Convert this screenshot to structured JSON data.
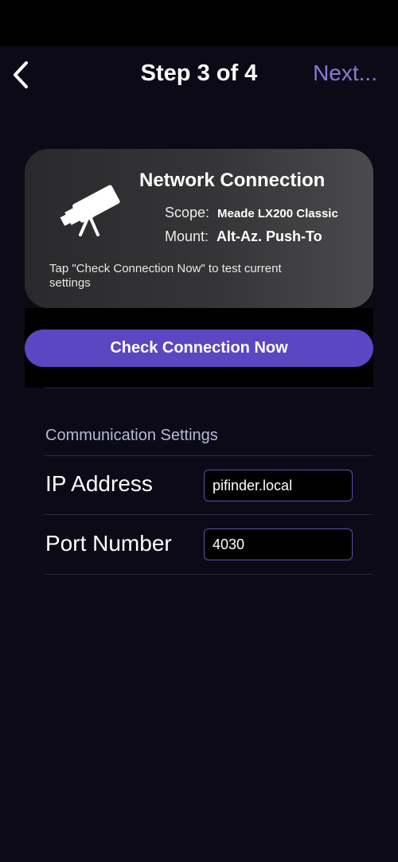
{
  "nav": {
    "back_icon": "chevron-left-icon",
    "title": "Step 3 of 4",
    "next_label": "Next..."
  },
  "card": {
    "icon": "telescope-icon",
    "title": "Network Connection",
    "scope_label": "Scope:",
    "scope_value": "Meade LX200 Classic",
    "mount_label": "Mount:",
    "mount_value": "Alt-Az. Push-To",
    "hint": "Tap \"Check Connection Now\" to test current settings"
  },
  "check_button": {
    "label": "Check Connection Now"
  },
  "settings": {
    "header": "Communication Settings",
    "ip_label": "IP Address",
    "ip_value": "pifinder.local",
    "port_label": "Port Number",
    "port_value": "4030"
  },
  "colors": {
    "background": "#0d0a17",
    "accent": "#5b47c2",
    "next": "#8b7ad6",
    "section_header": "#b3b9d6"
  }
}
